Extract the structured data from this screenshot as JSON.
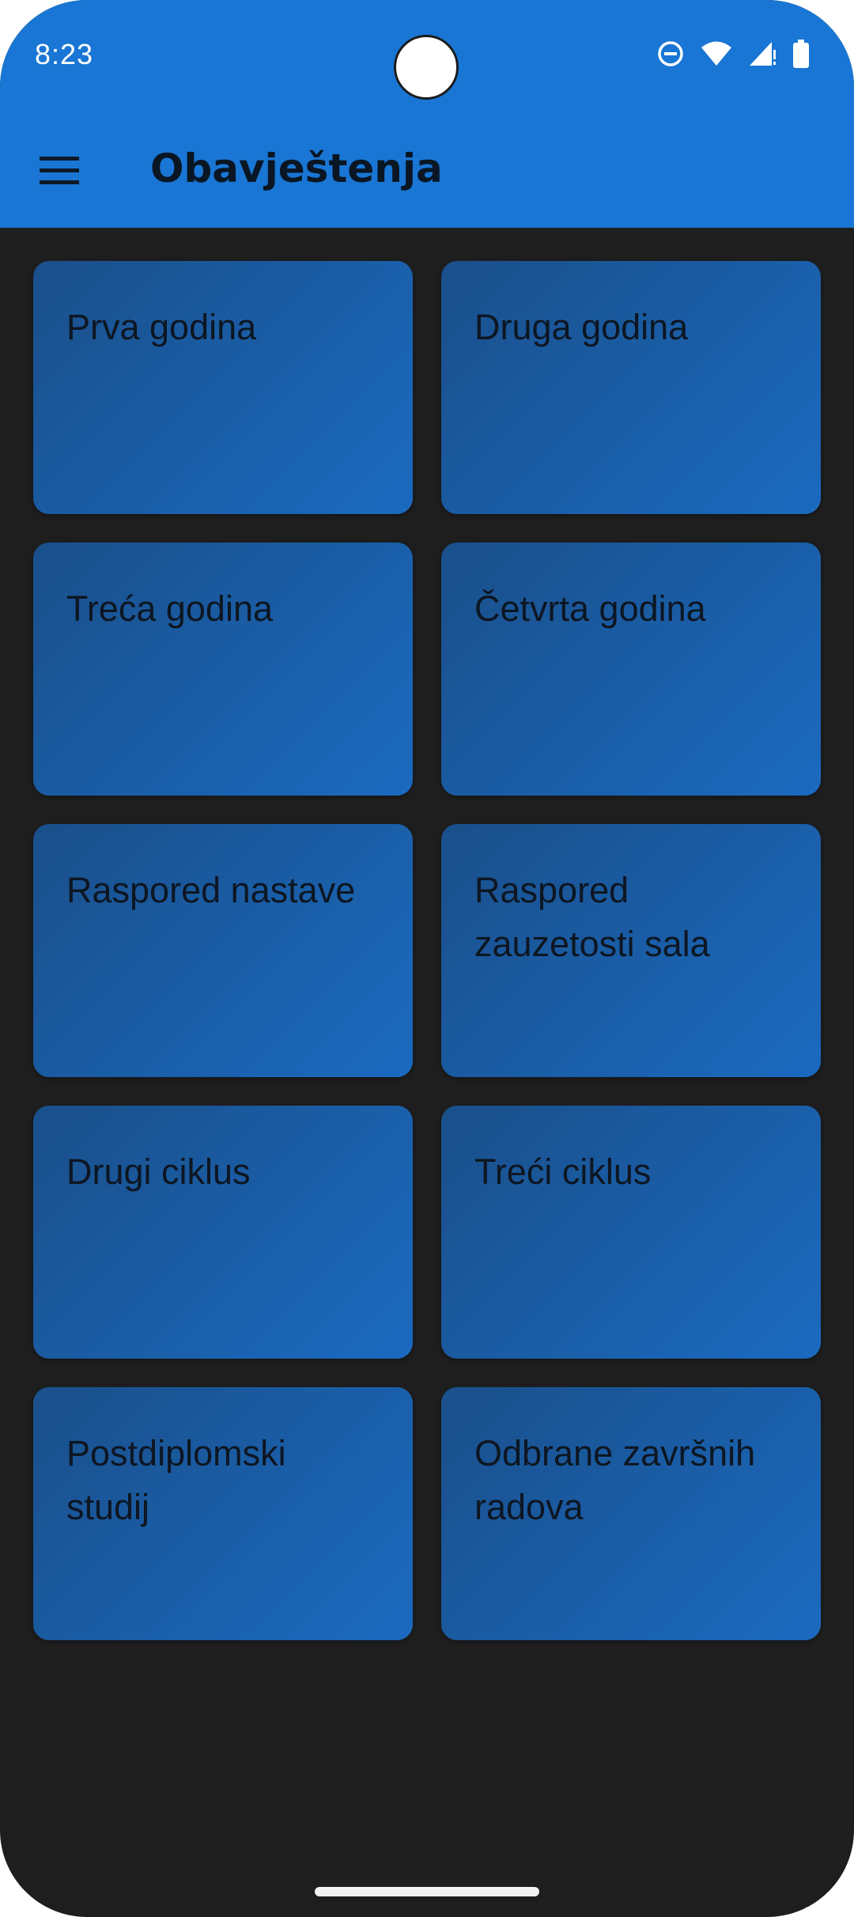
{
  "status_bar": {
    "time": "8:23",
    "icons": [
      "do-not-disturb-icon",
      "wifi-icon",
      "signal-icon",
      "battery-icon"
    ]
  },
  "app_bar": {
    "menu_icon": "hamburger-menu-icon",
    "title": "Obavještenja",
    "color": "#1976d4"
  },
  "tiles": [
    {
      "label": "Prva godina"
    },
    {
      "label": "Druga godina"
    },
    {
      "label": "Treća godina"
    },
    {
      "label": "Četvrta godina"
    },
    {
      "label": "Raspored nastave"
    },
    {
      "label": "Raspored\nzauzetosti sala"
    },
    {
      "label": "Drugi ciklus"
    },
    {
      "label": "Treći ciklus"
    },
    {
      "label": "Postdiplomski\nstudij"
    },
    {
      "label": "Odbrane završnih\nradova"
    }
  ]
}
